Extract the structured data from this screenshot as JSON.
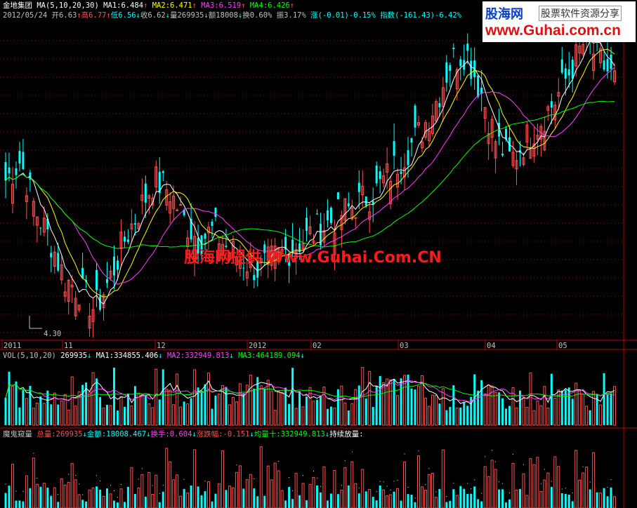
{
  "header": {
    "stock_name": "金地集团",
    "ma_params": "MA(5,10,20,30)",
    "ma1": "MA1:6.484",
    "ma2": "MA2:6.471",
    "ma3": "MA3:6.519",
    "ma4": "MA4:6.426",
    "date": "2012/05/24",
    "open": "开6.63",
    "high_label": "高",
    "high_value": "6.77",
    "low_label": "低",
    "low_value": "6.56",
    "close": "收6.62",
    "volume": "量269935",
    "amount": "额18008",
    "turnover": "换0.60%",
    "amplitude": "振3.17%",
    "change": "涨(-0.01)-0.15%",
    "index": "指数(-161.43)-6.42%",
    "arrow_up": "↑",
    "arrow_down": "↓"
  },
  "logo": {
    "name": "股海网",
    "tag": "股票软件资源分享",
    "url": "www.Guhai.com.cn"
  },
  "watermark": "股海网提供 Www.Guhai.Com.CN",
  "low_marker": "4.30",
  "time_axis": [
    "2011",
    "11",
    "12",
    "2012",
    "02",
    "03",
    "04",
    "05"
  ],
  "vol_panel": {
    "params": "VOL(5,10,20)",
    "value": "269935",
    "ma1": "MA1:334855.406",
    "ma2": "MA2:332949.813",
    "ma3": "MA3:464189.094"
  },
  "indicator_panel": {
    "name": "魔鬼窥量",
    "total": "总量:269935",
    "amount": "金额:18008.467",
    "turnover": "换手:0.604",
    "change": "涨跌幅:-0.151",
    "avg": "均量十:332949.813",
    "sustained": "持续放量:"
  },
  "colors": {
    "up": "#ff5050",
    "down": "#00ffff",
    "ma1": "#ffffff",
    "ma2": "#ffff00",
    "ma3": "#ff40ff",
    "ma4": "#00ff00",
    "grid": "#a00000",
    "axis_red": "#c00000"
  },
  "price_range": {
    "min": 4.0,
    "max": 7.2
  },
  "chart_data": {
    "type": "candlestick",
    "sample_closes": [
      5.6,
      5.8,
      5.3,
      5.0,
      4.6,
      4.5,
      4.3,
      4.6,
      5.0,
      5.3,
      5.6,
      5.5,
      5.2,
      5.0,
      5.1,
      4.9,
      4.8,
      4.7,
      4.8,
      4.9,
      5.0,
      5.1,
      5.2,
      5.3,
      5.4,
      5.5,
      5.7,
      5.9,
      6.1,
      6.4,
      6.8,
      6.9,
      6.5,
      6.0,
      5.8,
      6.0,
      6.2,
      6.4,
      6.7,
      7.0,
      6.8,
      6.6
    ]
  }
}
